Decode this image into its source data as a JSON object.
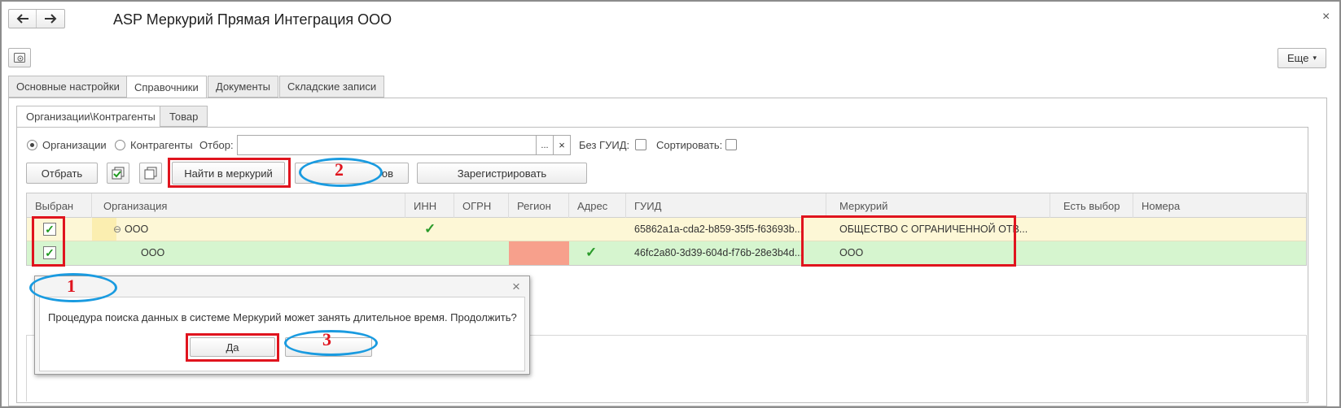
{
  "window": {
    "title": "ASP Меркурий Прямая Интеграция ООО",
    "back_icon": "arrow-left",
    "forward_icon": "arrow-right",
    "close_glyph": "×",
    "more_label": "Еще",
    "more_caret": "▾"
  },
  "tabs": [
    {
      "label": "Основные настройки",
      "active": false
    },
    {
      "label": "Справочники",
      "active": true
    },
    {
      "label": "Документы",
      "active": false
    },
    {
      "label": "Складские записи",
      "active": false
    }
  ],
  "subtabs": [
    {
      "label": "Организации\\Контрагенты",
      "active": true
    },
    {
      "label": "Товар",
      "active": false
    }
  ],
  "filter": {
    "radio_org": "Организации",
    "radio_contr": "Контрагенты",
    "selected": "Организации",
    "otbor_label": "Отбор:",
    "otbor_value": "",
    "select_btn": "...",
    "clear_btn": "×",
    "no_guid_label": "Без ГУИД:",
    "sort_label": "Сортировать:"
  },
  "toolbar": {
    "select_label": "Отбрать",
    "find_label": "Найти в меркурий",
    "hidden_label_suffix": "ов",
    "register_label": "Зарегистрировать"
  },
  "grid": {
    "columns": [
      "Выбран",
      "Организация",
      "ИНН",
      "ОГРН",
      "Регион",
      "Адрес",
      "ГУИД",
      "Меркурий",
      "Есть выбор",
      "Номера"
    ],
    "rows": [
      {
        "selected": true,
        "expander": "⊖",
        "org": "ООО",
        "inn_check": true,
        "ogrn": "",
        "region": "",
        "addr_check": false,
        "guid": "65862a1a-cda2-b859-35f5-f63693b...",
        "mercury": "ОБЩЕСТВО С ОГРАНИЧЕННОЙ ОТВ..."
      },
      {
        "selected": true,
        "expander": "",
        "org": "ООО",
        "inn_check": false,
        "ogrn": "",
        "region": "",
        "addr_check": true,
        "guid": "46fc2a80-3d39-604d-f76b-28e3b4d...",
        "mercury": "ООО"
      }
    ],
    "check_glyph": "✓",
    "colors": {
      "row1": "#fdf7d6",
      "row2": "#d6f5cf",
      "region_error": "#f7a08c"
    }
  },
  "dialog": {
    "message": "Процедура поиска данных в системе Меркурий может занять длительное время. Продолжить?",
    "yes_label": "Да",
    "no_label": "",
    "close_glyph": "×"
  },
  "annotations": {
    "marker_1": "1",
    "marker_2": "2",
    "marker_3": "3",
    "highlight_color": "#e0141e",
    "ellipse_color": "#1a9be0"
  }
}
